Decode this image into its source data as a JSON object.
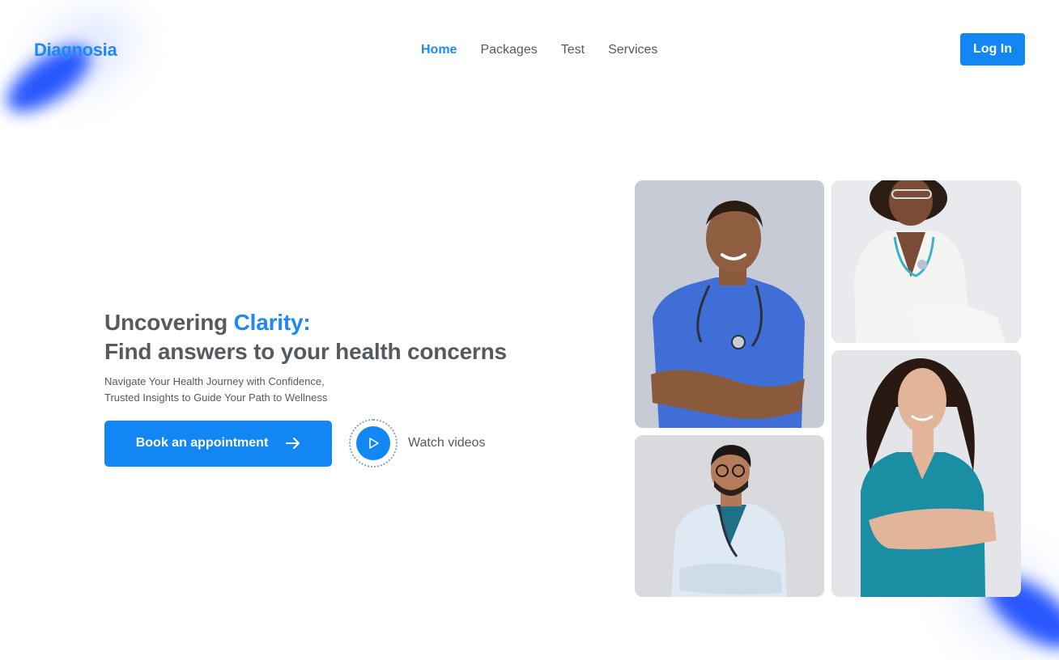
{
  "header": {
    "logo": "Diagnosia",
    "nav": [
      {
        "label": "Home",
        "active": true
      },
      {
        "label": "Packages",
        "active": false
      },
      {
        "label": "Test",
        "active": false
      },
      {
        "label": "Services",
        "active": false
      }
    ],
    "login_label": "Log In"
  },
  "hero": {
    "headline_prefix": "Uncovering ",
    "headline_accent": "Clarity:",
    "headline_line2": "Find answers to your health concerns",
    "subtext_line1": "Navigate Your Health Journey with Confidence,",
    "subtext_line2": "Trusted Insights to Guide Your Path to Wellness",
    "book_label": "Book an appointment",
    "watch_label": "Watch videos"
  },
  "photos": [
    {
      "name": "doctor-photo-blue-scrubs"
    },
    {
      "name": "doctor-photo-white-suit"
    },
    {
      "name": "doctor-photo-lab-coat"
    },
    {
      "name": "doctor-photo-teal-scrubs"
    }
  ],
  "colors": {
    "brand": "#1e88f5",
    "button": "#1286f3",
    "text": "#555a60",
    "blob": "#1f4fff"
  },
  "icons": [
    "arrow-right-icon",
    "play-icon"
  ]
}
